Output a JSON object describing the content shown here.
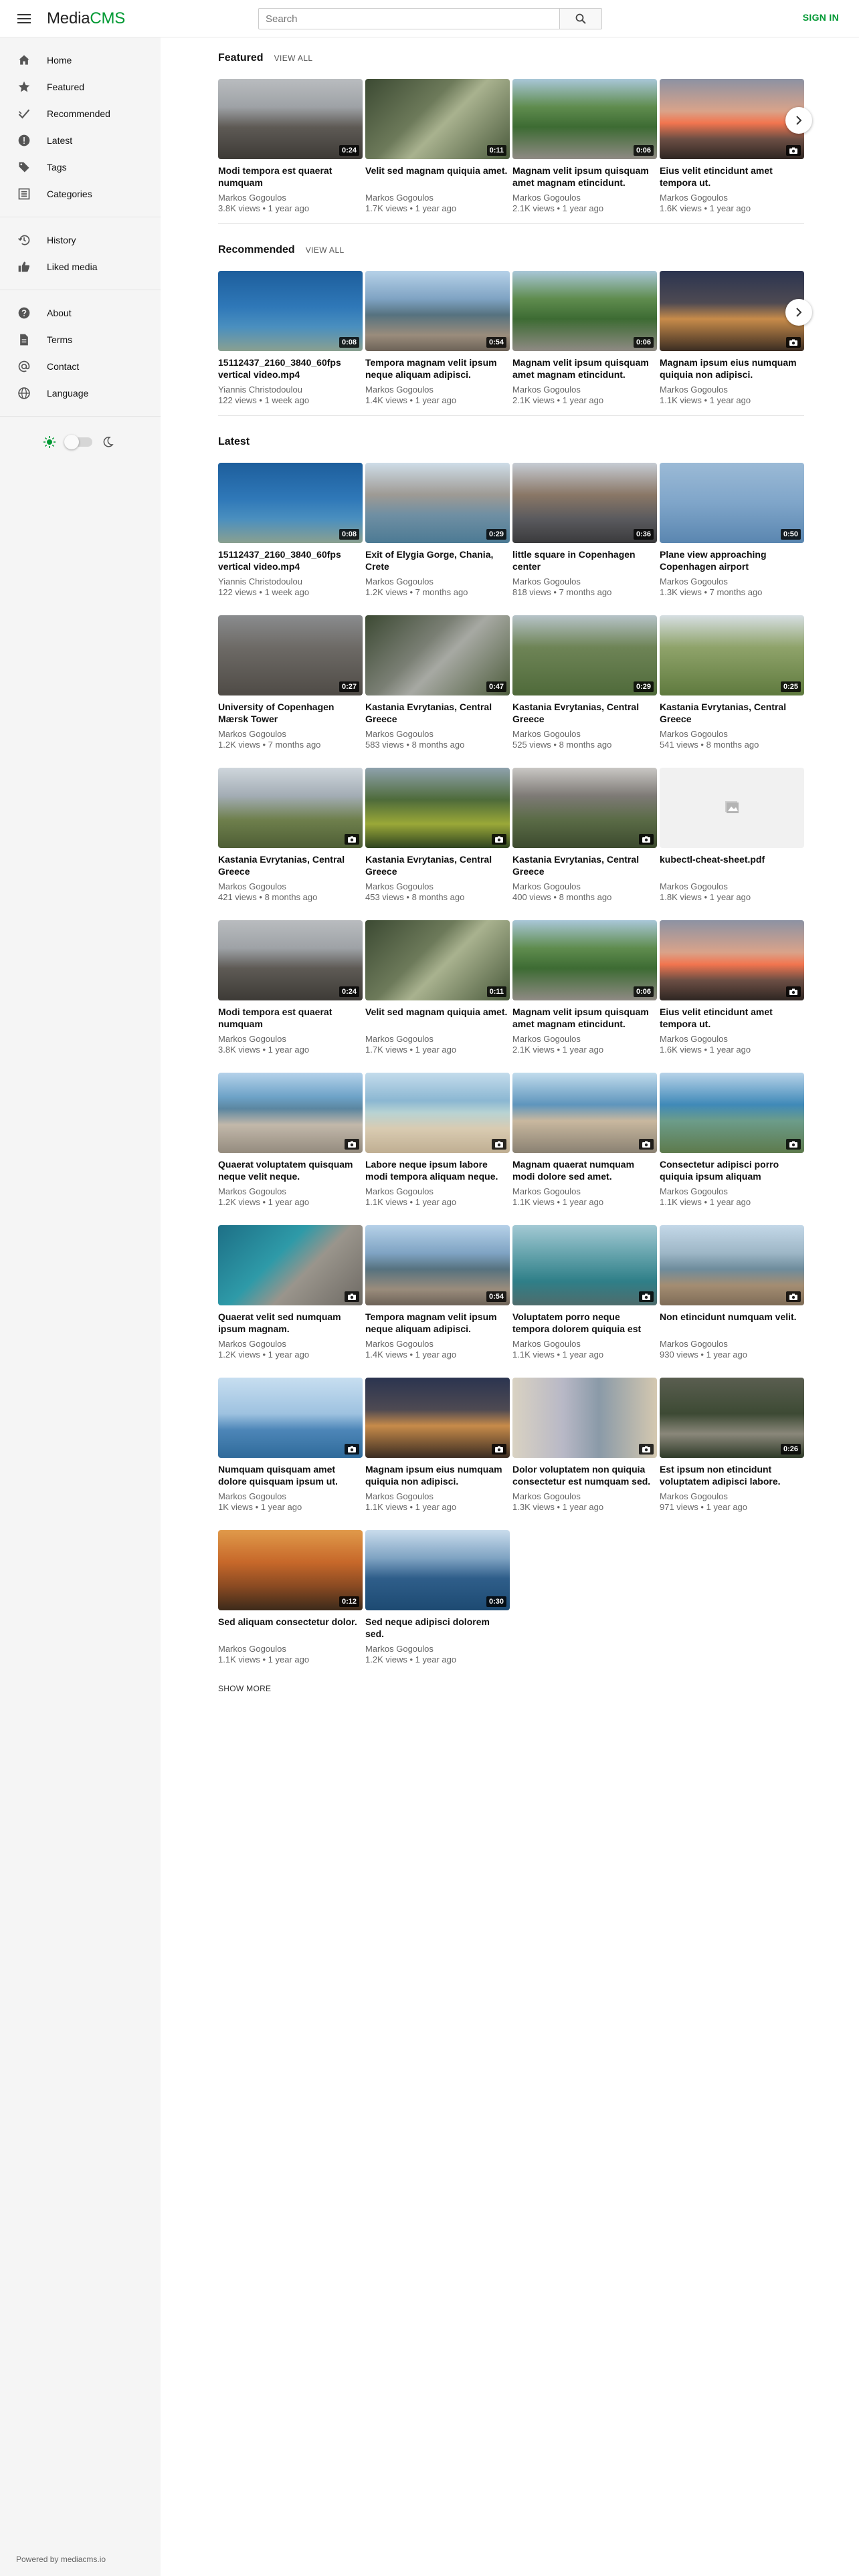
{
  "header": {
    "logo_a": "Media",
    "logo_b": "CMS",
    "search_placeholder": "Search",
    "sign_in": "SIGN IN"
  },
  "sidebar": {
    "groups": [
      [
        {
          "label": "Home",
          "icon": "home-icon"
        },
        {
          "label": "Featured",
          "icon": "star-icon"
        },
        {
          "label": "Recommended",
          "icon": "checkmark-icon"
        },
        {
          "label": "Latest",
          "icon": "alert-circle-icon"
        },
        {
          "label": "Tags",
          "icon": "tag-icon"
        },
        {
          "label": "Categories",
          "icon": "list-icon"
        }
      ],
      [
        {
          "label": "History",
          "icon": "history-icon"
        },
        {
          "label": "Liked media",
          "icon": "thumb-up-icon"
        }
      ],
      [
        {
          "label": "About",
          "icon": "help-icon"
        },
        {
          "label": "Terms",
          "icon": "document-icon"
        },
        {
          "label": "Contact",
          "icon": "at-icon"
        },
        {
          "label": "Language",
          "icon": "globe-icon"
        }
      ]
    ],
    "powered_by": "Powered by mediacms.io"
  },
  "sections": {
    "featured": {
      "title": "Featured",
      "view_all": "VIEW ALL",
      "items": [
        {
          "title": "Modi tempora est quaerat numquam",
          "author": "Markos Gogoulos",
          "meta": "3.8K views • 1 year ago",
          "duration": "0:24",
          "thumb": "mist-mountain"
        },
        {
          "title": "Velit sed magnam quiquia amet.",
          "author": "Markos Gogoulos",
          "meta": "1.7K views • 1 year ago",
          "duration": "0:11",
          "thumb": "leaves"
        },
        {
          "title": "Magnam velit ipsum quisquam amet magnam etincidunt.",
          "author": "Markos Gogoulos",
          "meta": "2.1K views • 1 year ago",
          "duration": "0:06",
          "thumb": "forest-road"
        },
        {
          "title": "Eius velit etincidunt amet tempora ut.",
          "author": "Markos Gogoulos",
          "meta": "1.6K views • 1 year ago",
          "duration": "",
          "thumb": "sunset"
        }
      ]
    },
    "recommended": {
      "title": "Recommended",
      "view_all": "VIEW ALL",
      "items": [
        {
          "title": "15112437_2160_3840_60fps vertical video.mp4",
          "author": "Yiannis Christodoulou",
          "meta": "122 views • 1 week ago",
          "duration": "0:08",
          "thumb": "diver"
        },
        {
          "title": "Tempora magnam velit ipsum neque aliquam adipisci.",
          "author": "Markos Gogoulos",
          "meta": "1.4K views • 1 year ago",
          "duration": "0:54",
          "thumb": "rocky-bay"
        },
        {
          "title": "Magnam velit ipsum quisquam amet magnam etincidunt.",
          "author": "Markos Gogoulos",
          "meta": "2.1K views • 1 year ago",
          "duration": "0:06",
          "thumb": "forest-road"
        },
        {
          "title": "Magnam ipsum eius numquam quiquia non adipisci.",
          "author": "Markos Gogoulos",
          "meta": "1.1K views • 1 year ago",
          "duration": "",
          "thumb": "night-cafe"
        }
      ]
    },
    "latest": {
      "title": "Latest",
      "show_more": "SHOW MORE",
      "items": [
        {
          "title": "15112437_2160_3840_60fps vertical video.mp4",
          "author": "Yiannis Christodoulou",
          "meta": "122 views • 1 week ago",
          "duration": "0:08",
          "thumb": "diver"
        },
        {
          "title": "Exit of Elygia Gorge, Chania, Crete",
          "author": "Markos Gogoulos",
          "meta": "1.2K views • 7 months ago",
          "duration": "0:29",
          "thumb": "gorge"
        },
        {
          "title": "little square in Copenhagen center",
          "author": "Markos Gogoulos",
          "meta": "818 views • 7 months ago",
          "duration": "0:36",
          "thumb": "city-square"
        },
        {
          "title": "Plane view approaching Copenhagen airport",
          "author": "Markos Gogoulos",
          "meta": "1.3K views • 7 months ago",
          "duration": "0:50",
          "thumb": "plane-view"
        },
        {
          "title": "University of Copenhagen Mærsk Tower",
          "author": "Markos Gogoulos",
          "meta": "1.2K views • 7 months ago",
          "duration": "0:27",
          "thumb": "city-grey"
        },
        {
          "title": "Kastania Evrytanias, Central Greece",
          "author": "Markos Gogoulos",
          "meta": "583 views • 8 months ago",
          "duration": "0:47",
          "thumb": "stream"
        },
        {
          "title": "Kastania Evrytanias, Central Greece",
          "author": "Markos Gogoulos",
          "meta": "525 views • 8 months ago",
          "duration": "0:29",
          "thumb": "hills-green"
        },
        {
          "title": "Kastania Evrytanias, Central Greece",
          "author": "Markos Gogoulos",
          "meta": "541 views • 8 months ago",
          "duration": "0:25",
          "thumb": "green-slope"
        },
        {
          "title": "Kastania Evrytanias, Central Greece",
          "author": "Markos Gogoulos",
          "meta": "421 views • 8 months ago",
          "duration": "",
          "thumb": "village-sky"
        },
        {
          "title": "Kastania Evrytanias, Central Greece",
          "author": "Markos Gogoulos",
          "meta": "453 views • 8 months ago",
          "duration": "",
          "thumb": "yellow-flowers"
        },
        {
          "title": "Kastania Evrytanias, Central Greece",
          "author": "Markos Gogoulos",
          "meta": "400 views • 8 months ago",
          "duration": "",
          "thumb": "valley"
        },
        {
          "title": "kubectl-cheat-sheet.pdf",
          "author": "Markos Gogoulos",
          "meta": "1.8K views • 1 year ago",
          "duration": "",
          "thumb": "pdf"
        },
        {
          "title": "Modi tempora est quaerat numquam",
          "author": "Markos Gogoulos",
          "meta": "3.8K views • 1 year ago",
          "duration": "0:24",
          "thumb": "mist-mountain"
        },
        {
          "title": "Velit sed magnam quiquia amet.",
          "author": "Markos Gogoulos",
          "meta": "1.7K views • 1 year ago",
          "duration": "0:11",
          "thumb": "leaves"
        },
        {
          "title": "Magnam velit ipsum quisquam amet magnam etincidunt.",
          "author": "Markos Gogoulos",
          "meta": "2.1K views • 1 year ago",
          "duration": "0:06",
          "thumb": "forest-road"
        },
        {
          "title": "Eius velit etincidunt amet tempora ut.",
          "author": "Markos Gogoulos",
          "meta": "1.6K views • 1 year ago",
          "duration": "",
          "thumb": "sunset"
        },
        {
          "title": "Quaerat voluptatem quisquam neque velit neque.",
          "author": "Markos Gogoulos",
          "meta": "1.2K views • 1 year ago",
          "duration": "",
          "thumb": "pebble-beach"
        },
        {
          "title": "Labore neque ipsum labore modi tempora aliquam neque.",
          "author": "Markos Gogoulos",
          "meta": "1.1K views • 1 year ago",
          "duration": "",
          "thumb": "sand-beach"
        },
        {
          "title": "Magnam quaerat numquam modi dolore sed amet.",
          "author": "Markos Gogoulos",
          "meta": "1.1K views • 1 year ago",
          "duration": "",
          "thumb": "cliff-beach"
        },
        {
          "title": "Consectetur adipisci porro quiquia ipsum aliquam etincidun...",
          "author": "Markos Gogoulos",
          "meta": "1.1K views • 1 year ago",
          "duration": "",
          "thumb": "coast"
        },
        {
          "title": "Quaerat velit sed numquam ipsum magnam.",
          "author": "Markos Gogoulos",
          "meta": "1.2K views • 1 year ago",
          "duration": "",
          "thumb": "turquoise-rocks"
        },
        {
          "title": "Tempora magnam velit ipsum neque aliquam adipisci.",
          "author": "Markos Gogoulos",
          "meta": "1.4K views • 1 year ago",
          "duration": "0:54",
          "thumb": "rocky-bay"
        },
        {
          "title": "Voluptatem porro neque tempora dolorem quiquia est dolor.",
          "author": "Markos Gogoulos",
          "meta": "1.1K views • 1 year ago",
          "duration": "",
          "thumb": "clear-water"
        },
        {
          "title": "Non etincidunt numquam velit.",
          "author": "Markos Gogoulos",
          "meta": "930 views • 1 year ago",
          "duration": "",
          "thumb": "shore-hills"
        },
        {
          "title": "Numquam quisquam amet dolore quisquam ipsum ut.",
          "author": "Markos Gogoulos",
          "meta": "1K views • 1 year ago",
          "duration": "",
          "thumb": "calm-sea"
        },
        {
          "title": "Magnam ipsum eius numquam quiquia non adipisci.",
          "author": "Markos Gogoulos",
          "meta": "1.1K views • 1 year ago",
          "duration": "",
          "thumb": "night-cafe"
        },
        {
          "title": "Dolor voluptatem non quiquia consectetur est numquam sed.",
          "author": "Markos Gogoulos",
          "meta": "1.3K views • 1 year ago",
          "duration": "",
          "thumb": "painting"
        },
        {
          "title": "Est ipsum non etincidunt voluptatem adipisci labore.",
          "author": "Markos Gogoulos",
          "meta": "971 views • 1 year ago",
          "duration": "0:26",
          "thumb": "dark-forest"
        },
        {
          "title": "Sed aliquam consectetur dolor.",
          "author": "Markos Gogoulos",
          "meta": "1.1K views • 1 year ago",
          "duration": "0:12",
          "thumb": "autumn"
        },
        {
          "title": "Sed neque adipisci dolorem sed.",
          "author": "Markos Gogoulos",
          "meta": "1.2K views • 1 year ago",
          "duration": "0:30",
          "thumb": "lake"
        }
      ]
    }
  }
}
